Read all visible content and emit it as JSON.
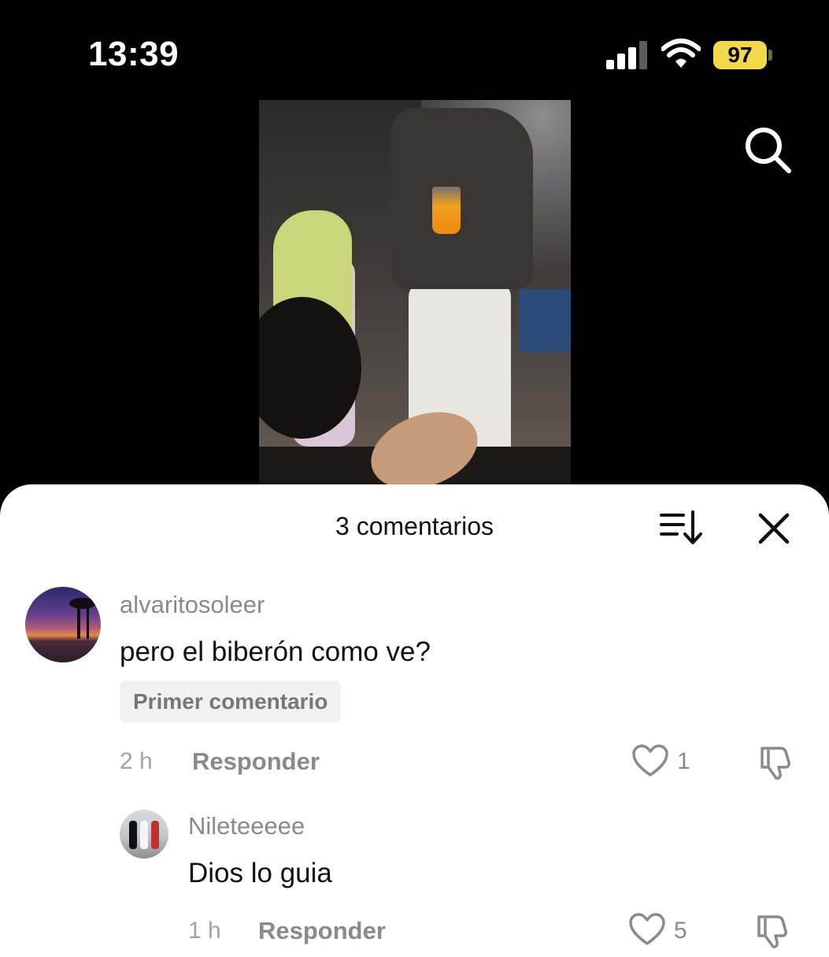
{
  "status_bar": {
    "time": "13:39",
    "battery": "97"
  },
  "video": {
    "description_icon": "search-icon"
  },
  "comments_panel": {
    "title": "3 comentarios",
    "sort_icon": "sort-icon",
    "close_icon": "close-icon",
    "comments": [
      {
        "username": "alvaritosoleer",
        "text": "pero el biberón como ve?",
        "badge": "Primer comentario",
        "time": "2 h",
        "reply_label": "Responder",
        "likes": "1"
      },
      {
        "username": "Nileteeeee",
        "text": "Dios lo guia",
        "time": "1 h",
        "reply_label": "Responder",
        "likes": "5"
      }
    ]
  },
  "colors": {
    "battery": "#f3d84a",
    "sheet": "#ffffff",
    "muted_text": "#8a8a8a"
  }
}
